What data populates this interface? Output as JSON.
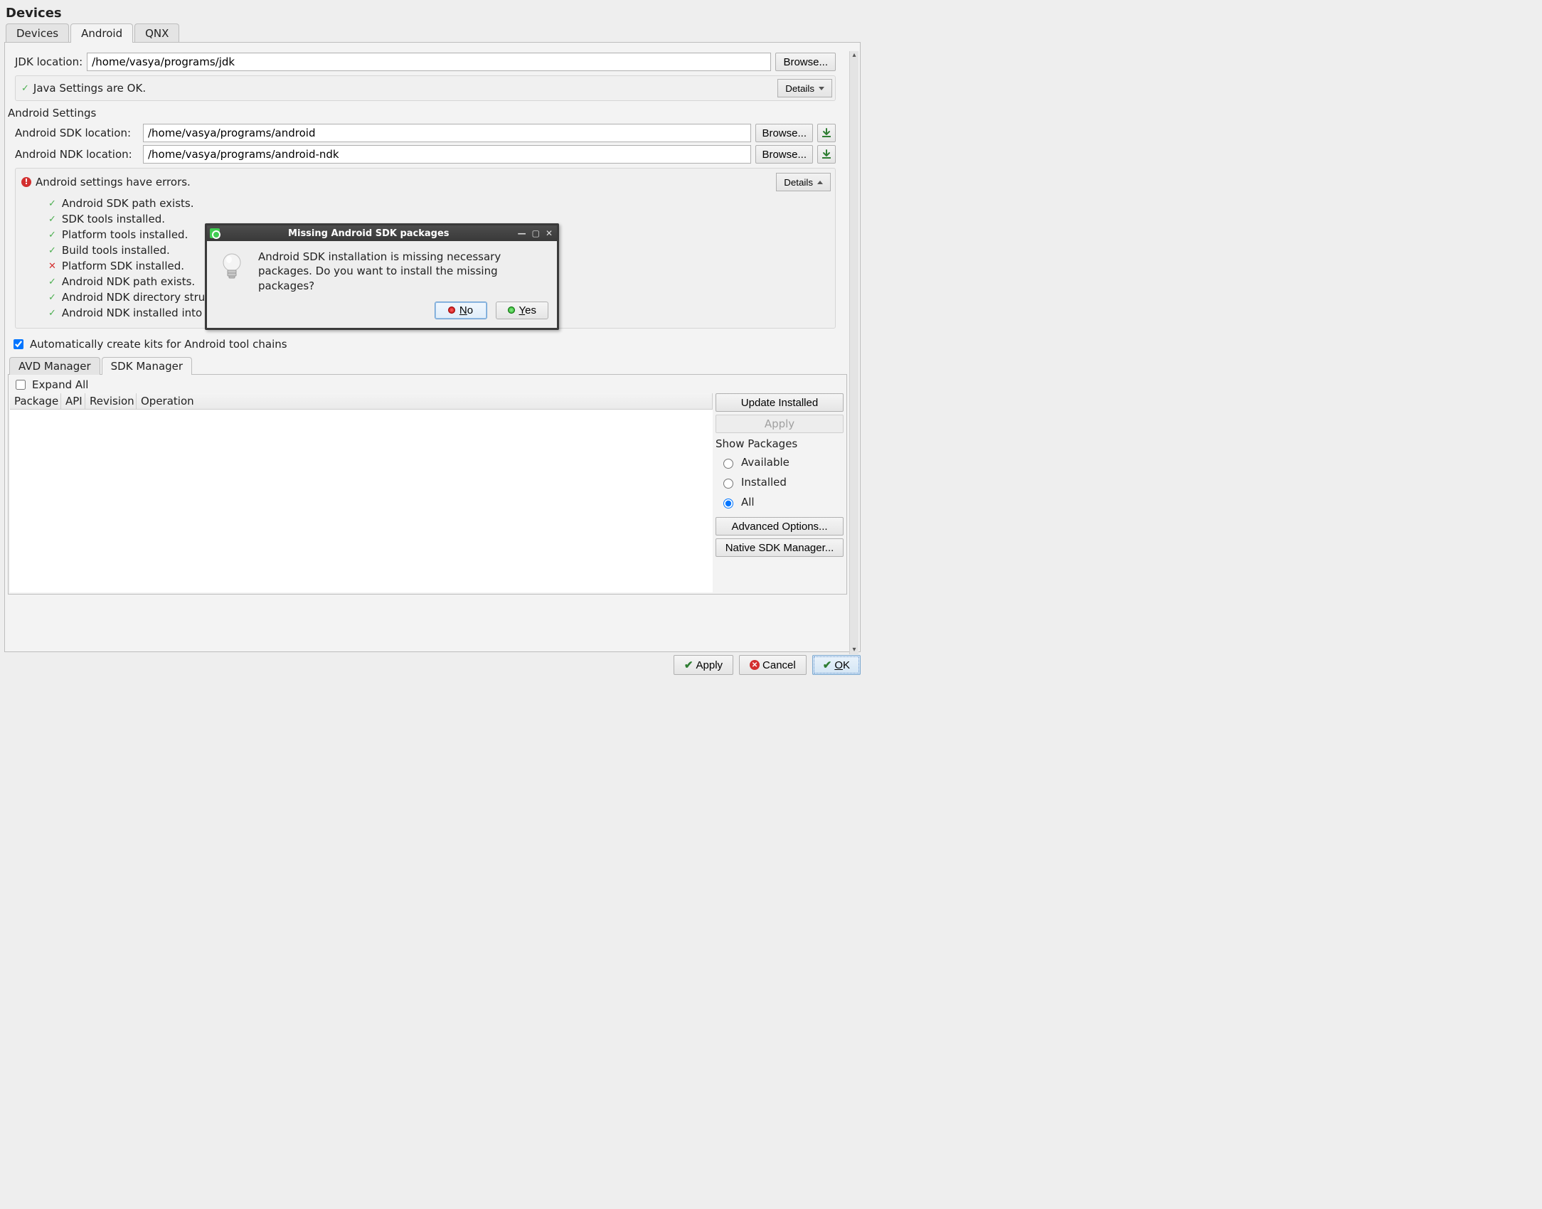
{
  "page_title": "Devices",
  "tabs": [
    "Devices",
    "Android",
    "QNX"
  ],
  "active_tab": "Android",
  "jdk": {
    "label": "JDK location:",
    "value": "/home/vasya/programs/jdk",
    "browse": "Browse...",
    "status_msg": "Java Settings are OK.",
    "details_label": "Details"
  },
  "android_section_title": "Android Settings",
  "sdk": {
    "label": "Android SDK location:",
    "value": "/home/vasya/programs/android",
    "browse": "Browse..."
  },
  "ndk": {
    "label": "Android NDK location:",
    "value": "/home/vasya/programs/android-ndk",
    "browse": "Browse..."
  },
  "android_status": {
    "msg": "Android settings have errors.",
    "details_label": "Details"
  },
  "checks": [
    {
      "ok": true,
      "text": "Android SDK path exists."
    },
    {
      "ok": true,
      "text": "SDK tools installed."
    },
    {
      "ok": true,
      "text": "Platform tools installed."
    },
    {
      "ok": true,
      "text": "Build tools installed."
    },
    {
      "ok": false,
      "text": "Platform SDK installed."
    },
    {
      "ok": true,
      "text": "Android NDK path exists."
    },
    {
      "ok": true,
      "text": "Android NDK directory structure is correct."
    },
    {
      "ok": true,
      "text": "Android NDK installed into a path without spaces."
    }
  ],
  "auto_kits": {
    "checked": true,
    "label": "Automatically create kits for Android tool chains"
  },
  "subtabs": [
    "AVD Manager",
    "SDK Manager"
  ],
  "active_subtab": "SDK Manager",
  "expand_all": {
    "checked": false,
    "label": "Expand All"
  },
  "pkg_columns": [
    "Package",
    "API",
    "Revision",
    "Operation"
  ],
  "pkg_buttons": {
    "update": "Update Installed",
    "apply": "Apply",
    "show_title": "Show Packages",
    "available": "Available",
    "installed": "Installed",
    "all": "All",
    "selected": "All",
    "advanced": "Advanced Options...",
    "native": "Native SDK Manager..."
  },
  "footer": {
    "apply": "Apply",
    "cancel": "Cancel",
    "ok": "OK"
  },
  "dialog": {
    "title": "Missing Android SDK packages",
    "body": "Android SDK installation is missing necessary packages. Do you want to install the missing packages?",
    "no": "No",
    "yes": "Yes"
  }
}
